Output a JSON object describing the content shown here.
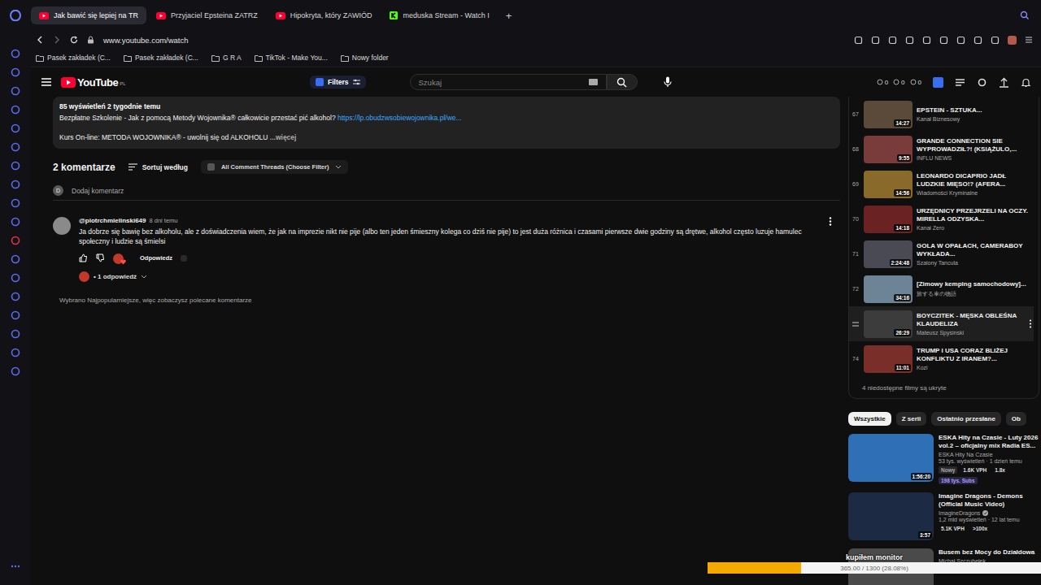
{
  "browser": {
    "tabs": [
      {
        "label": "Jak bawić się lepiej na TR",
        "selected": true,
        "kind": "youtube"
      },
      {
        "label": "Przyjaciel Epsteina ZATRZ",
        "selected": false,
        "kind": "youtube"
      },
      {
        "label": "Hipokryta, który ZAWIÓD",
        "selected": false,
        "kind": "youtube"
      },
      {
        "label": "meduska Stream - Watch I",
        "selected": false,
        "kind": "kick"
      }
    ],
    "new_tab": "+",
    "address": "www.youtube.com/watch",
    "bookmarks": [
      "Pasek zakładek (C...",
      "Pasek zakładek (C...",
      "G R A",
      "TikTok - Make You...",
      "Nowy folder"
    ]
  },
  "header": {
    "logo": "YouTube",
    "region": "PL",
    "filters": "Filters",
    "search_placeholder": "Szukaj",
    "counters": [
      "0",
      "0",
      "0"
    ]
  },
  "description": {
    "meta": "85 wyświetleń  2 tygodnie temu",
    "line1": "Bezpłatne Szkolenie - Jak z pomocą Metody Wojownika® całkowicie przestać pić alkohol?",
    "link": "https://lp.obudzwsobiewojownika.pl/we...",
    "line2": "Kurs On-line: METODA WOJOWNIKA® - uwolnij się od ALKOHOLU",
    "more": "...więcej"
  },
  "comments": {
    "count": "2 komentarze",
    "sort": "Sortuj według",
    "filter": "All Comment Threads (Choose Filter)",
    "add_avatar": "D",
    "add_placeholder": "Dodaj komentarz",
    "items": [
      {
        "author": "@piotrchmielinski649",
        "time": "8 dni temu",
        "text": "Ja dobrze się bawię bez alkoholu, ale z doświadczenia wiem, że jak na imprezie nikt nie pije (albo ten jeden śmieszny kolega co dziś nie pije) to jest duża różnica i czasami pierwsze dwie godziny są drętwe, alkohol często luzuje hamulec społeczny i ludzie są śmielsi",
        "reply": "Odpowiedz",
        "replies": "• 1 odpowiedź",
        "hearted": true
      }
    ],
    "note": "Wybrano Najpopularniejsze, więc zobaczysz polecane komentarze"
  },
  "playlist": {
    "items": [
      {
        "index": "67",
        "title": "EPSTEIN - SZTUKA...",
        "channel": "Kanał Biznesowy",
        "duration": "14:27",
        "hovered": false
      },
      {
        "index": "68",
        "title": "GRANDE CONNECTION SIE WYPROWADZIŁ?! (KSIĄŻULO,...",
        "channel": "INFLU NEWS",
        "duration": "9:55",
        "hovered": false
      },
      {
        "index": "69",
        "title": "LEONARDO DICAPRIO JADŁ LUDZKIE MIĘSO!? (AFERA...",
        "channel": "Wiadomości Kryminalne",
        "duration": "14:56",
        "hovered": false
      },
      {
        "index": "70",
        "title": "URZĘDNICY PRZEJRZELI NA OCZY. MIRELLA ODZYSKA...",
        "channel": "Kanał Zero",
        "duration": "14:18",
        "hovered": false
      },
      {
        "index": "71",
        "title": "GOLA W OPAŁACH, CAMERABOY WYKŁADA...",
        "channel": "Szalony Tancula",
        "duration": "2:24:48",
        "hovered": false
      },
      {
        "index": "72",
        "title": "[Zimowy kemping samochodowy]...",
        "channel": "旅する車の物語",
        "duration": "34:16",
        "hovered": false
      },
      {
        "title": "BOYCZITEK - MĘSKA OBLEŚNA KLAUDELIZA",
        "channel": "Mateusz Spysinski",
        "duration": "26:29",
        "hovered": true
      },
      {
        "index": "74",
        "title": "TRUMP I USA CORAZ BLIŻEJ KONFLIKTU Z IRANEM?...",
        "channel": "Kozi",
        "duration": "11:01",
        "hovered": false
      }
    ],
    "hidden_note": "4 niedostępne filmy są ukryte"
  },
  "chips": [
    {
      "label": "Wszystkie",
      "selected": true
    },
    {
      "label": "Z serii",
      "selected": false
    },
    {
      "label": "Ostatnio przesłane",
      "selected": false
    },
    {
      "label": "Ob",
      "selected": false
    }
  ],
  "recommendations": [
    {
      "title": "ESKA Hity na Czasie - Luty 2026 vol.2 – oficjalny mix Radia ES...",
      "channel": "ESKA Hity Na Czasie",
      "verified": false,
      "stats": "53 tys. wyświetleń · 1 dzień temu",
      "duration": "1:56:20",
      "badges": [
        {
          "label": "Nowy",
          "kind": "new"
        },
        {
          "label": "1.6K VPH",
          "kind": "vph"
        },
        {
          "label": "1.8x",
          "kind": "ratio"
        },
        {
          "label": "198 tys. Subs",
          "kind": "subs"
        }
      ]
    },
    {
      "title": "Imagine Dragons - Demons (Official Music Video)",
      "channel": "ImagineDragons",
      "verified": true,
      "stats": "1,2 mld wyświetleń · 12 lat temu",
      "duration": "3:57",
      "badges": [
        {
          "label": "5.1K VPH",
          "kind": "vph"
        },
        {
          "label": ">100x",
          "kind": "ratio"
        }
      ]
    },
    {
      "title": "Busem bez Mocy do Działdowa",
      "channel": "Michał Szczubełek",
      "verified": false,
      "stats": "",
      "duration": "",
      "badges": []
    }
  ],
  "overlay": {
    "label": "kupiłem monitor",
    "reading": "365.00 / 1300 (28.08%)",
    "level": 0.2808
  }
}
